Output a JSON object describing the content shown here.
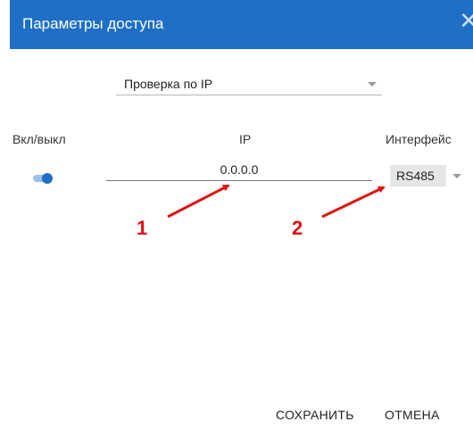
{
  "dialog": {
    "title": "Параметры доступа",
    "close_icon": "close-icon"
  },
  "mode_select": {
    "value": "Проверка по IP"
  },
  "columns": {
    "onoff": "Вкл/выкл",
    "ip": "IP",
    "interface": "Интерфейс"
  },
  "row": {
    "enabled": true,
    "ip_value": "0.0.0.0",
    "interface_value": "RS485"
  },
  "annotations": {
    "marker_1": "1",
    "marker_2": "2",
    "color": "#e01212"
  },
  "actions": {
    "save_label": "СОХРАНИТЬ",
    "cancel_label": "ОТМЕНА"
  },
  "colors": {
    "header_bg": "#1f6fc4",
    "toggle_on": "#1f6fc4"
  }
}
